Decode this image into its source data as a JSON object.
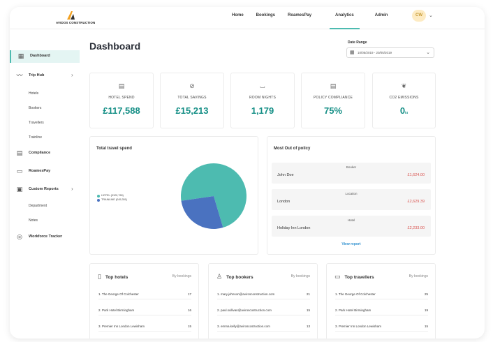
{
  "brand": {
    "name": "AVIDOS CONSTRUCTION"
  },
  "nav": {
    "items": [
      "Home",
      "Bookings",
      "RoamesPay",
      "Analytics",
      "Admin"
    ],
    "active": "Analytics",
    "avatar_initials": "CW"
  },
  "sidebar": {
    "dashboard": "Dashboard",
    "trip_hub": "Trip Hub",
    "trip_hub_sub": [
      "Hotels",
      "Bookers",
      "Travellers",
      "Trainline"
    ],
    "compliance": "Compliance",
    "roamespay": "RoamesPay",
    "custom_reports": "Custom Reports",
    "custom_reports_sub": [
      "Department",
      "Notes"
    ],
    "workforce": "Workforce Tracker"
  },
  "page": {
    "title": "Dashboard",
    "date_range_label": "Date Range",
    "date_range_value": "10/05/2019 - 20/05/2019"
  },
  "kpis": [
    {
      "label": "HOTEL SPEND",
      "value": "£117,588",
      "icon": "receipt-icon"
    },
    {
      "label": "TOTAL SAVINGS",
      "value": "£15,213",
      "icon": "savings-icon"
    },
    {
      "label": "ROOM NIGHTS",
      "value": "1,179",
      "icon": "bed-icon"
    },
    {
      "label": "POLICY COMPLIANCE",
      "value": "75%",
      "icon": "clipboard-icon"
    },
    {
      "label": "CO2 EMISSIONS",
      "value": "0",
      "unit": "kt",
      "icon": "leaf-icon"
    }
  ],
  "travel_spend": {
    "title": "Total travel spend",
    "colors": {
      "hotel": "#4dbbb0",
      "trainline": "#4a72c0"
    }
  },
  "chart_data": {
    "type": "pie",
    "slices": [
      {
        "label": "HOTEL (£120,769)",
        "value": 120769
      },
      {
        "label": "TRAINLINE (£45,351)",
        "value": 45351
      }
    ]
  },
  "out_of_policy": {
    "title": "Most Out of policy",
    "rows": [
      {
        "category": "Booker",
        "name": "John Doe",
        "amount": "£1,624.00"
      },
      {
        "category": "Location",
        "name": "London",
        "amount": "£2,629.39"
      },
      {
        "category": "Hotel",
        "name": "Holiday Inn London",
        "amount": "£2,233.00"
      }
    ],
    "view_report": "View report"
  },
  "top_hotels": {
    "title": "Top hotels",
    "sort": "By bookings",
    "rows": [
      {
        "name": "1. The George Of Colchester",
        "count": "17"
      },
      {
        "name": "2. Park Hotel Birmingham",
        "count": "16"
      },
      {
        "name": "3. Premier Inn London Lewisham",
        "count": "15"
      }
    ]
  },
  "top_bookers": {
    "title": "Top bookers",
    "sort": "By bookings",
    "rows": [
      {
        "name": "1. mary.johnson@avirosconstruction.com",
        "count": "21"
      },
      {
        "name": "2. paul.sullivan@aviroscostruction.com",
        "count": "15"
      },
      {
        "name": "3. emma.kelly@aviroscostruction.com",
        "count": "13"
      }
    ]
  },
  "top_travellers": {
    "title": "Top travellers",
    "sort": "By bookings",
    "rows": [
      {
        "name": "1. The George Of Colchester",
        "count": "25"
      },
      {
        "name": "2. Park Hotel Birmingham",
        "count": "19"
      },
      {
        "name": "3. Premier Inn London Lewisham",
        "count": "15"
      }
    ]
  }
}
